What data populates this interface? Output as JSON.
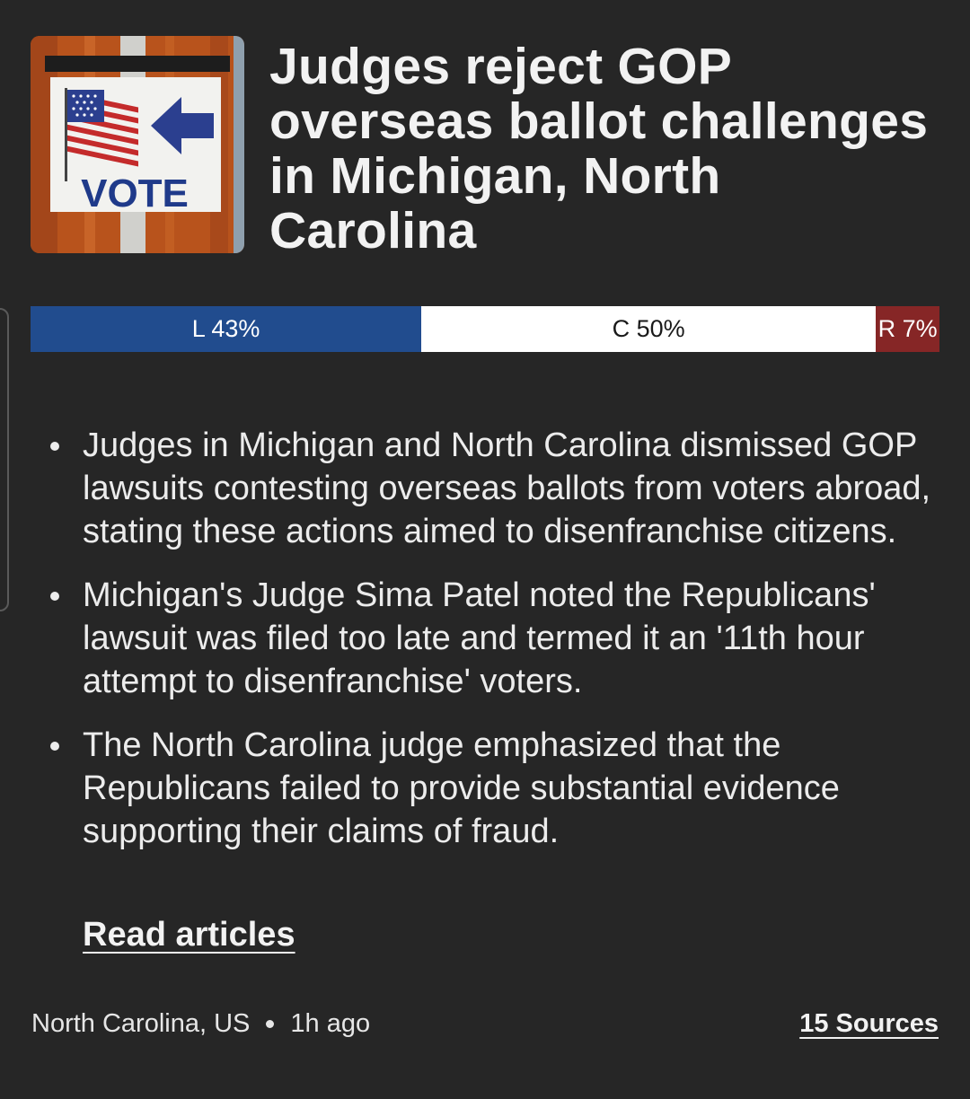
{
  "article": {
    "headline": "Judges reject GOP overseas ballot challenges in Michigan, North Carolina",
    "thumbnail": {
      "sign_text": "VOTE",
      "icon": "vote-sign-image"
    }
  },
  "bias": {
    "left": {
      "label": "L 43%",
      "share": 43,
      "color": "#214c8e"
    },
    "center": {
      "label": "C 50%",
      "share": 50,
      "color": "#ffffff"
    },
    "right": {
      "label": "R 7%",
      "share": 7,
      "color": "#862626"
    }
  },
  "summary": [
    "Judges in Michigan and North Carolina dismissed GOP lawsuits contesting overseas ballots from voters abroad, stating these actions aimed to disenfranchise citizens.",
    "Michigan's Judge Sima Patel noted the Republicans' lawsuit was filed too late and termed it an '11th hour attempt to disenfranchise' voters.",
    "The North Carolina judge emphasized that the Republicans failed to provide substantial evidence supporting their claims of fraud."
  ],
  "read_articles_label": "Read articles",
  "footer": {
    "location": "North Carolina, US",
    "time": "1h ago",
    "sources_label": "15 Sources"
  }
}
